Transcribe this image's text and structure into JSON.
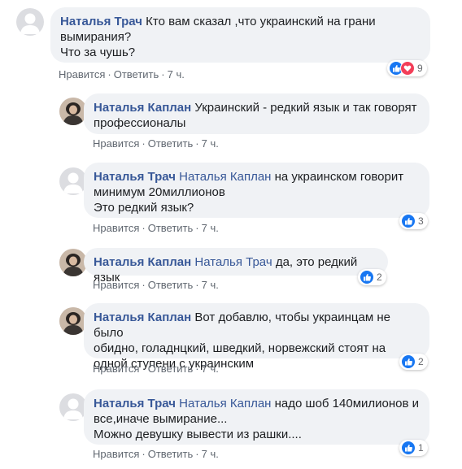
{
  "comments": [
    {
      "author": "Наталья Трач",
      "mention": "",
      "text_line1": "Кто вам сказал ,что украинский на грани",
      "text_line2": "вымирания?",
      "text_line3": "Что за чушь?",
      "like_label": "Нравится",
      "reply_label": "Ответить",
      "time": "7 ч.",
      "reaction_count": "9",
      "reactions": [
        "like-icon",
        "love-icon"
      ]
    },
    {
      "author": "Наталья Каплан",
      "mention": "",
      "text_line1": "Украинский - редкий язык и так говорят",
      "text_line2": "профессионалы",
      "like_label": "Нравится",
      "reply_label": "Ответить",
      "time": "7 ч."
    },
    {
      "author": "Наталья Трач",
      "mention": "Наталья Каплан",
      "text_line1": "на украинском говорит",
      "text_line2": "минимум 20миллионов",
      "text_line3": "Это редкий язык?",
      "like_label": "Нравится",
      "reply_label": "Ответить",
      "time": "7 ч.",
      "reaction_count": "3",
      "reactions": [
        "like-icon"
      ]
    },
    {
      "author": "Наталья Каплан",
      "mention": "Наталья Трач",
      "text_line1": "да, это редкий язык",
      "like_label": "Нравится",
      "reply_label": "Ответить",
      "time": "7 ч.",
      "reaction_count": "2",
      "reactions": [
        "like-icon"
      ]
    },
    {
      "author": "Наталья Каплан",
      "mention": "",
      "text_line1": "Вот добавлю, чтобы украинцам не было",
      "text_line2": "обидно, голаднцкий, шведкий, норвежский стоят на",
      "text_line3": "одной ступени с украинским",
      "like_label": "Нравится",
      "reply_label": "Ответить",
      "time": "7 ч.",
      "reaction_count": "2",
      "reactions": [
        "like-icon"
      ]
    },
    {
      "author": "Наталья Трач",
      "mention": "Наталья Каплан",
      "text_line1": "надо шоб 140милионов и",
      "text_line2": "все,иначе вымирание...",
      "text_line3": "Можно девушку вывести из рашки....",
      "like_label": "Нравится",
      "reply_label": "Ответить",
      "time": "7 ч.",
      "reaction_count": "1",
      "reactions": [
        "like-icon"
      ]
    }
  ],
  "colors": {
    "name": "#385898",
    "bubble": "#f0f2f5",
    "meta": "#606770",
    "like": "#1877f2",
    "love": "#f33e58"
  }
}
